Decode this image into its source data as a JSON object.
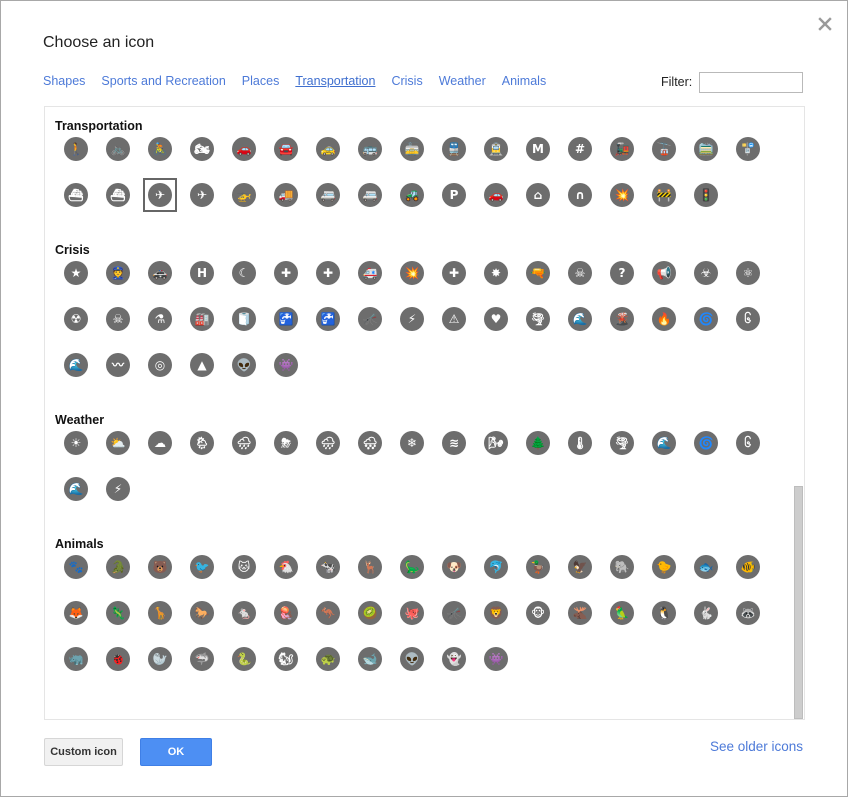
{
  "dialog": {
    "title": "Choose an icon",
    "close_icon": "close-icon"
  },
  "tabs": [
    {
      "label": "Shapes",
      "active": false
    },
    {
      "label": "Sports and Recreation",
      "active": false
    },
    {
      "label": "Places",
      "active": false
    },
    {
      "label": "Transportation",
      "active": true
    },
    {
      "label": "Crisis",
      "active": false
    },
    {
      "label": "Weather",
      "active": false
    },
    {
      "label": "Animals",
      "active": false
    }
  ],
  "filter": {
    "label": "Filter:",
    "value": "",
    "placeholder": ""
  },
  "sections": [
    {
      "title": "Transportation",
      "icons": [
        {
          "name": "pedestrian",
          "glyph": "🚶"
        },
        {
          "name": "bicycle",
          "glyph": "🚲"
        },
        {
          "name": "cyclist",
          "glyph": "🚴"
        },
        {
          "name": "motorcycle",
          "glyph": "🏍"
        },
        {
          "name": "car",
          "glyph": "🚗"
        },
        {
          "name": "car-rental",
          "glyph": "🚘"
        },
        {
          "name": "taxi",
          "glyph": "🚕"
        },
        {
          "name": "bus",
          "glyph": "🚌"
        },
        {
          "name": "tram",
          "glyph": "🚋"
        },
        {
          "name": "train",
          "glyph": "🚆"
        },
        {
          "name": "tram-overhead",
          "glyph": "🚊"
        },
        {
          "name": "metro",
          "glyph": "M"
        },
        {
          "name": "rail",
          "glyph": "#"
        },
        {
          "name": "steam-train",
          "glyph": "🚂"
        },
        {
          "name": "gondola",
          "glyph": "🚡"
        },
        {
          "name": "funicular",
          "glyph": "🚞"
        },
        {
          "name": "bus-stop",
          "glyph": "🚏"
        },
        {
          "name": "ferry",
          "glyph": "⛴"
        },
        {
          "name": "car-ferry",
          "glyph": "⛴"
        },
        {
          "name": "airplane",
          "glyph": "✈",
          "selected": true
        },
        {
          "name": "small-plane",
          "glyph": "✈"
        },
        {
          "name": "helicopter",
          "glyph": "🚁"
        },
        {
          "name": "truck",
          "glyph": "🚚"
        },
        {
          "name": "caravan",
          "glyph": "🚐"
        },
        {
          "name": "camper",
          "glyph": "🚐"
        },
        {
          "name": "tractor",
          "glyph": "🚜"
        },
        {
          "name": "parking",
          "glyph": "P"
        },
        {
          "name": "car-wash",
          "glyph": "🚗"
        },
        {
          "name": "bridge",
          "glyph": "⌂"
        },
        {
          "name": "tunnel",
          "glyph": "∩"
        },
        {
          "name": "car-crash",
          "glyph": "💥"
        },
        {
          "name": "road-work",
          "glyph": "🚧"
        },
        {
          "name": "traffic-light",
          "glyph": "🚦"
        }
      ]
    },
    {
      "title": "Crisis",
      "icons": [
        {
          "name": "police-badge",
          "glyph": "★"
        },
        {
          "name": "police-officer",
          "glyph": "👮"
        },
        {
          "name": "police-car",
          "glyph": "🚓"
        },
        {
          "name": "hospital",
          "glyph": "H"
        },
        {
          "name": "red-crescent",
          "glyph": "☾"
        },
        {
          "name": "red-cross",
          "glyph": "✚"
        },
        {
          "name": "medical-shield",
          "glyph": "✚"
        },
        {
          "name": "ambulance",
          "glyph": "🚑"
        },
        {
          "name": "accident",
          "glyph": "💥"
        },
        {
          "name": "first-aid",
          "glyph": "✚"
        },
        {
          "name": "explosion",
          "glyph": "✸"
        },
        {
          "name": "gun",
          "glyph": "🔫"
        },
        {
          "name": "poison",
          "glyph": "☠"
        },
        {
          "name": "missing-person",
          "glyph": "?"
        },
        {
          "name": "megaphone",
          "glyph": "📢"
        },
        {
          "name": "biohazard",
          "glyph": "☣"
        },
        {
          "name": "atom",
          "glyph": "⚛"
        },
        {
          "name": "radiation",
          "glyph": "☢"
        },
        {
          "name": "gas-mask",
          "glyph": "☠"
        },
        {
          "name": "chemical-flask",
          "glyph": "⚗"
        },
        {
          "name": "factory",
          "glyph": "🏭"
        },
        {
          "name": "toilet-paper",
          "glyph": "🧻"
        },
        {
          "name": "water-tap",
          "glyph": "🚰"
        },
        {
          "name": "water-leak",
          "glyph": "🚰"
        },
        {
          "name": "mosquito",
          "glyph": "🦟"
        },
        {
          "name": "power-outage",
          "glyph": "⚡"
        },
        {
          "name": "warning",
          "glyph": "⚠"
        },
        {
          "name": "helping-hands",
          "glyph": "♥"
        },
        {
          "name": "tornado",
          "glyph": "🌪"
        },
        {
          "name": "tsunami",
          "glyph": "🌊"
        },
        {
          "name": "volcano",
          "glyph": "🌋"
        },
        {
          "name": "fire",
          "glyph": "🔥"
        },
        {
          "name": "hurricane",
          "glyph": "🌀"
        },
        {
          "name": "typhoon",
          "glyph": "၆"
        },
        {
          "name": "flood",
          "glyph": "🌊"
        },
        {
          "name": "earthquake",
          "glyph": "〰"
        },
        {
          "name": "epicenter",
          "glyph": "◎"
        },
        {
          "name": "landslide",
          "glyph": "▲"
        },
        {
          "name": "alien",
          "glyph": "👽"
        },
        {
          "name": "monster",
          "glyph": "👾"
        }
      ]
    },
    {
      "title": "Weather",
      "icons": [
        {
          "name": "sun",
          "glyph": "☀"
        },
        {
          "name": "partly-cloudy",
          "glyph": "⛅"
        },
        {
          "name": "cloudy",
          "glyph": "☁"
        },
        {
          "name": "light-rain",
          "glyph": "🌦"
        },
        {
          "name": "rain",
          "glyph": "🌧"
        },
        {
          "name": "thunderstorm",
          "glyph": "⛈"
        },
        {
          "name": "drizzle",
          "glyph": "🌧"
        },
        {
          "name": "sleet",
          "glyph": "🌨"
        },
        {
          "name": "snowflake",
          "glyph": "❄"
        },
        {
          "name": "fog",
          "glyph": "≋"
        },
        {
          "name": "wind",
          "glyph": "🌬"
        },
        {
          "name": "cold-wind",
          "glyph": "🌲"
        },
        {
          "name": "thermometer",
          "glyph": "🌡"
        },
        {
          "name": "tornado",
          "glyph": "🌪"
        },
        {
          "name": "tsunami",
          "glyph": "🌊"
        },
        {
          "name": "hurricane",
          "glyph": "🌀"
        },
        {
          "name": "typhoon",
          "glyph": "၆"
        },
        {
          "name": "flood",
          "glyph": "🌊"
        },
        {
          "name": "lightning",
          "glyph": "⚡"
        }
      ]
    },
    {
      "title": "Animals",
      "icons": [
        {
          "name": "paw",
          "glyph": "🐾"
        },
        {
          "name": "crocodile",
          "glyph": "🐊"
        },
        {
          "name": "bear",
          "glyph": "🐻"
        },
        {
          "name": "bird",
          "glyph": "🐦"
        },
        {
          "name": "cat",
          "glyph": "🐱"
        },
        {
          "name": "chicken",
          "glyph": "🐔"
        },
        {
          "name": "cow",
          "glyph": "🐄"
        },
        {
          "name": "deer",
          "glyph": "🦌"
        },
        {
          "name": "dinosaur",
          "glyph": "🦕"
        },
        {
          "name": "dog",
          "glyph": "🐶"
        },
        {
          "name": "dolphin",
          "glyph": "🐬"
        },
        {
          "name": "duck",
          "glyph": "🦆"
        },
        {
          "name": "eagle",
          "glyph": "🦅"
        },
        {
          "name": "elephant",
          "glyph": "🐘"
        },
        {
          "name": "chick",
          "glyph": "🐤"
        },
        {
          "name": "fish",
          "glyph": "🐟"
        },
        {
          "name": "tropical-fish",
          "glyph": "🐠"
        },
        {
          "name": "fox",
          "glyph": "🦊"
        },
        {
          "name": "lizard",
          "glyph": "🦎"
        },
        {
          "name": "giraffe",
          "glyph": "🦒"
        },
        {
          "name": "horse",
          "glyph": "🐎"
        },
        {
          "name": "mouse",
          "glyph": "🐁"
        },
        {
          "name": "jellyfish",
          "glyph": "🪼"
        },
        {
          "name": "kangaroo",
          "glyph": "🦘"
        },
        {
          "name": "kiwi",
          "glyph": "🥝"
        },
        {
          "name": "octopus",
          "glyph": "🐙"
        },
        {
          "name": "mosquito",
          "glyph": "🦟"
        },
        {
          "name": "lion",
          "glyph": "🦁"
        },
        {
          "name": "monkey",
          "glyph": "🐵"
        },
        {
          "name": "moose",
          "glyph": "🫎"
        },
        {
          "name": "parrot",
          "glyph": "🦜"
        },
        {
          "name": "penguin",
          "glyph": "🐧"
        },
        {
          "name": "rabbit",
          "glyph": "🐇"
        },
        {
          "name": "raccoon",
          "glyph": "🦝"
        },
        {
          "name": "rhino",
          "glyph": "🦏"
        },
        {
          "name": "bug",
          "glyph": "🐞"
        },
        {
          "name": "seal",
          "glyph": "🦭"
        },
        {
          "name": "shark",
          "glyph": "🦈"
        },
        {
          "name": "snake",
          "glyph": "🐍"
        },
        {
          "name": "squirrel",
          "glyph": "🐿"
        },
        {
          "name": "turtle",
          "glyph": "🐢"
        },
        {
          "name": "whale",
          "glyph": "🐋"
        },
        {
          "name": "alien",
          "glyph": "👽"
        },
        {
          "name": "ghost",
          "glyph": "👻"
        },
        {
          "name": "monster",
          "glyph": "👾"
        }
      ]
    }
  ],
  "scrollbar": {
    "position_fraction": 0.62
  },
  "buttons": {
    "custom_icon": "Custom icon",
    "ok": "OK"
  },
  "links": {
    "see_older_icons": "See older icons"
  },
  "colors": {
    "icon_fill": "#6d6d6d",
    "link": "#4d7ad8",
    "primary_button": "#4d8ff3"
  }
}
